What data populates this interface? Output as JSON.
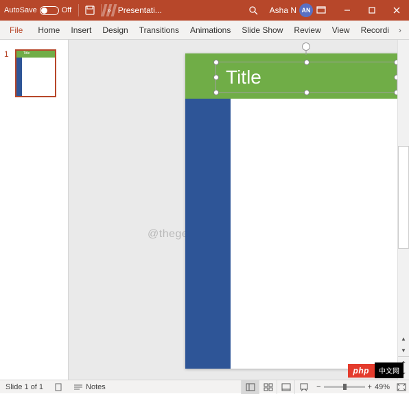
{
  "titlebar": {
    "autosave_label": "AutoSave",
    "autosave_state": "Off",
    "doc_title": "Presentati...",
    "user_name": "Asha N",
    "user_initials": "AN"
  },
  "ribbon": {
    "tabs": [
      "File",
      "Home",
      "Insert",
      "Design",
      "Transitions",
      "Animations",
      "Slide Show",
      "Review",
      "View",
      "Recordi"
    ]
  },
  "thumbnails": {
    "items": [
      {
        "number": "1",
        "title": "Title"
      }
    ]
  },
  "slide": {
    "title_placeholder": "Title"
  },
  "watermark": "@thegeekpage.com",
  "statusbar": {
    "slide_info": "Slide 1 of 1",
    "notes_label": "Notes",
    "zoom_value": "49%"
  },
  "badge": {
    "php": "php",
    "cn": "中文网"
  }
}
